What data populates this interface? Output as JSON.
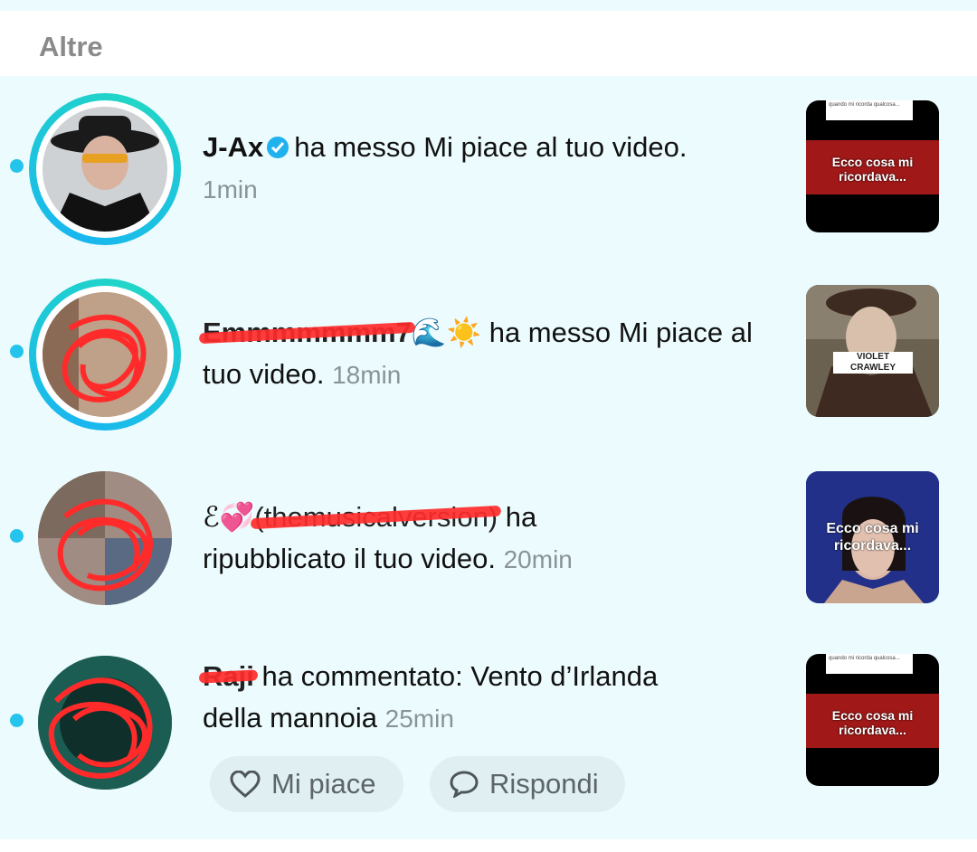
{
  "section": {
    "title": "Altre"
  },
  "notifications": [
    {
      "username": "J-Ax",
      "verified": true,
      "action": "ha messo Mi piace al tuo video.",
      "time": "1min",
      "thumb_caption": "Ecco cosa mi ricordava...",
      "thumb_note": "quando mi ricorda qualcosa..."
    },
    {
      "username": "Emmmmmmm7",
      "emoji": "🌊☀️",
      "action": "ha messo Mi piace al tuo video.",
      "action_line1": "ha messo Mi piace al",
      "action_line2": "tuo video.",
      "time": "18min",
      "thumb_caption": "VIOLET CRAWLEY"
    },
    {
      "username": "(themusicalversion)",
      "prefix": "ℰ💞",
      "action_line1": "ha",
      "action_line2": "ripubblicato il tuo video.",
      "time": "20min",
      "thumb_caption": "Ecco cosa mi ricordava..."
    },
    {
      "username": "Raji",
      "action_line1": "ha commentato: Vento d’Irlanda",
      "action_line2": "della mannoia",
      "time": "25min",
      "thumb_caption": "Ecco cosa mi ricordava...",
      "thumb_note": "quando mi ricorda qualcosa..."
    }
  ],
  "actions": {
    "like_label": "Mi piace",
    "reply_label": "Rispondi"
  },
  "colors": {
    "accent": "#25c4ec",
    "background": "#ecfbfd",
    "verified": "#20b1ef",
    "redaction": "#ff2b2b"
  }
}
